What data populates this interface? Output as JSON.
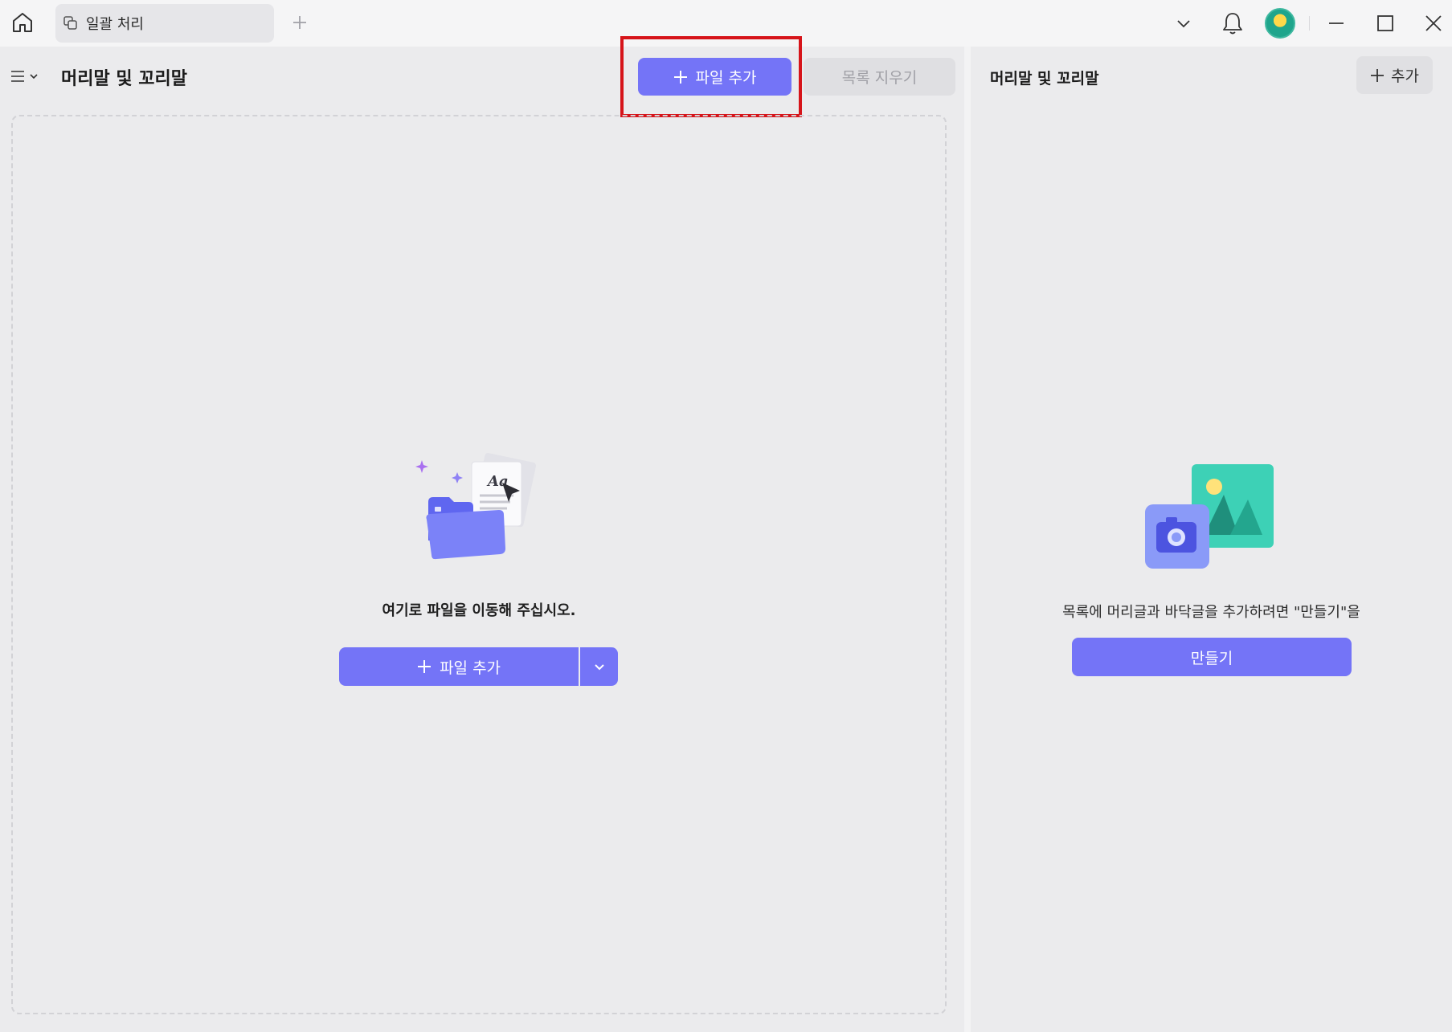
{
  "titlebar": {
    "tab_label": "일괄 처리"
  },
  "left": {
    "title": "머리말 및 꼬리말",
    "add_file_label": "파일 추가",
    "clear_list_label": "목록 지우기",
    "drop_hint": "여기로 파일을 이동해 주십시오.",
    "drop_add_file_label": "파일 추가"
  },
  "right": {
    "title": "머리말 및 꼬리말",
    "add_label": "추가",
    "hint": "목록에 머리글과 바닥글을 추가하려면 \"만들기\"을",
    "create_label": "만들기"
  },
  "colors": {
    "accent": "#7474f7",
    "highlight": "#d6141a",
    "background": "#ebebed"
  }
}
